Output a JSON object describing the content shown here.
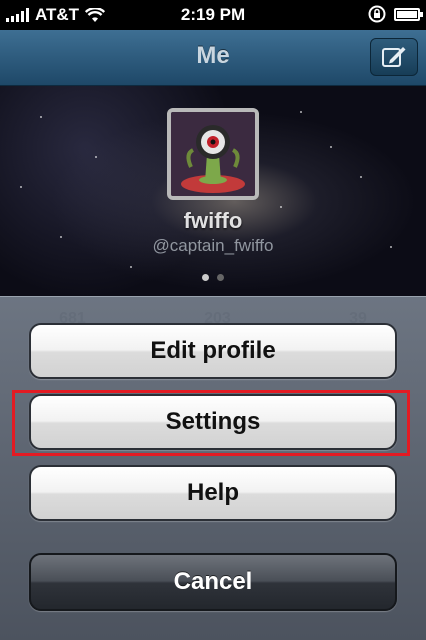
{
  "status_bar": {
    "carrier": "AT&T",
    "time": "2:19 PM",
    "battery_level": 1.0
  },
  "nav": {
    "title": "Me",
    "compose_icon": "compose-icon"
  },
  "profile": {
    "name": "fwiffo",
    "handle": "@captain_fwiffo",
    "page_count": 2,
    "current_page": 1
  },
  "background_stats": [
    "681",
    "203",
    "39"
  ],
  "action_sheet": {
    "buttons": [
      {
        "label": "Edit profile"
      },
      {
        "label": "Settings"
      },
      {
        "label": "Help"
      }
    ],
    "cancel_label": "Cancel"
  },
  "colors": {
    "nav_bar": "#2c5a7b",
    "highlight": "#e31b23"
  }
}
